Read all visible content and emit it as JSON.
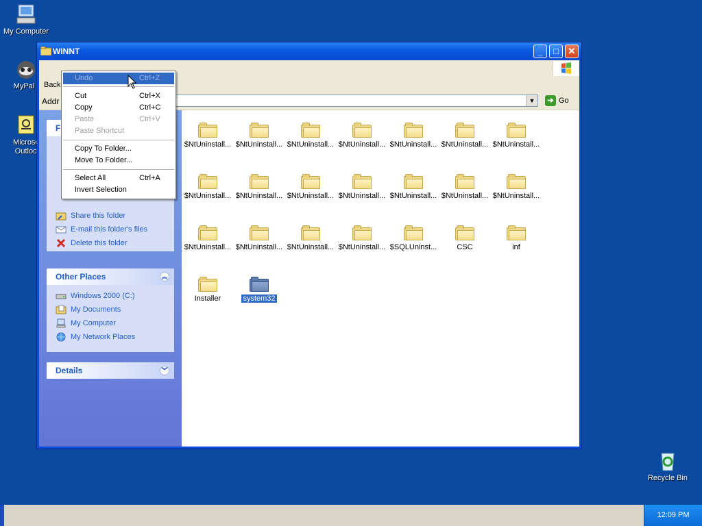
{
  "desktop": {
    "icons": [
      {
        "label": "My Computer",
        "icon": "computer-icon"
      },
      {
        "label": "MyPal t",
        "icon": "raccoon-icon"
      },
      {
        "label": "Microsc",
        "label2": "Outloo",
        "icon": "outlook-icon"
      },
      {
        "label": "Recycle Bin",
        "icon": "recycle-bin-icon"
      }
    ]
  },
  "window": {
    "title": "WINNT",
    "toolbar": {
      "back_label": "Back"
    },
    "address": {
      "label": "Addr",
      "go_label": "Go"
    }
  },
  "taskpane": {
    "file_tasks": {
      "title_fragment": "Fi",
      "items": [
        {
          "label": "Share this folder",
          "icon": "share-folder-icon"
        },
        {
          "label": "E-mail this folder's files",
          "icon": "email-icon"
        },
        {
          "label": "Delete this folder",
          "icon": "delete-x-icon"
        }
      ]
    },
    "other_places": {
      "title": "Other Places",
      "items": [
        {
          "label": "Windows 2000 (C:)",
          "icon": "drive-icon"
        },
        {
          "label": "My Documents",
          "icon": "my-documents-icon"
        },
        {
          "label": "My Computer",
          "icon": "computer-icon"
        },
        {
          "label": "My Network Places",
          "icon": "network-icon"
        }
      ]
    },
    "details": {
      "title": "Details"
    }
  },
  "files": [
    "$NtUninstall...",
    "$NtUninstall...",
    "$NtUninstall...",
    "$NtUninstall...",
    "$NtUninstall...",
    "$NtUninstall...",
    "$NtUninstall...",
    "$NtUninstall...",
    "$NtUninstall...",
    "$NtUninstall...",
    "$NtUninstall...",
    "$NtUninstall...",
    "$NtUninstall...",
    "$NtUninstall...",
    "$NtUninstall...",
    "$NtUninstall...",
    "$NtUninstall...",
    "$NtUninstall...",
    "$SQLUninst...",
    "CSC",
    "inf",
    "Installer",
    "system32"
  ],
  "selected_file": "system32",
  "context_menu": {
    "items": [
      {
        "label": "Undo",
        "shortcut": "Ctrl+Z",
        "state": "highlighted-disabled"
      },
      {
        "label": "Cut",
        "shortcut": "Ctrl+X",
        "state": "enabled"
      },
      {
        "label": "Copy",
        "shortcut": "Ctrl+C",
        "state": "enabled"
      },
      {
        "label": "Paste",
        "shortcut": "Ctrl+V",
        "state": "disabled"
      },
      {
        "label": "Paste Shortcut",
        "shortcut": "",
        "state": "disabled"
      },
      {
        "label": "Copy To Folder...",
        "shortcut": "",
        "state": "enabled"
      },
      {
        "label": "Move To Folder...",
        "shortcut": "",
        "state": "enabled"
      },
      {
        "label": "Select All",
        "shortcut": "Ctrl+A",
        "state": "enabled"
      },
      {
        "label": "Invert Selection",
        "shortcut": "",
        "state": "enabled"
      }
    ]
  },
  "taskbar": {
    "clock": "12:09 PM"
  },
  "colors": {
    "desktop": "#0c4aa0",
    "title_bar": "#0a5be0",
    "link": "#215dc6",
    "selection": "#316ac5"
  }
}
